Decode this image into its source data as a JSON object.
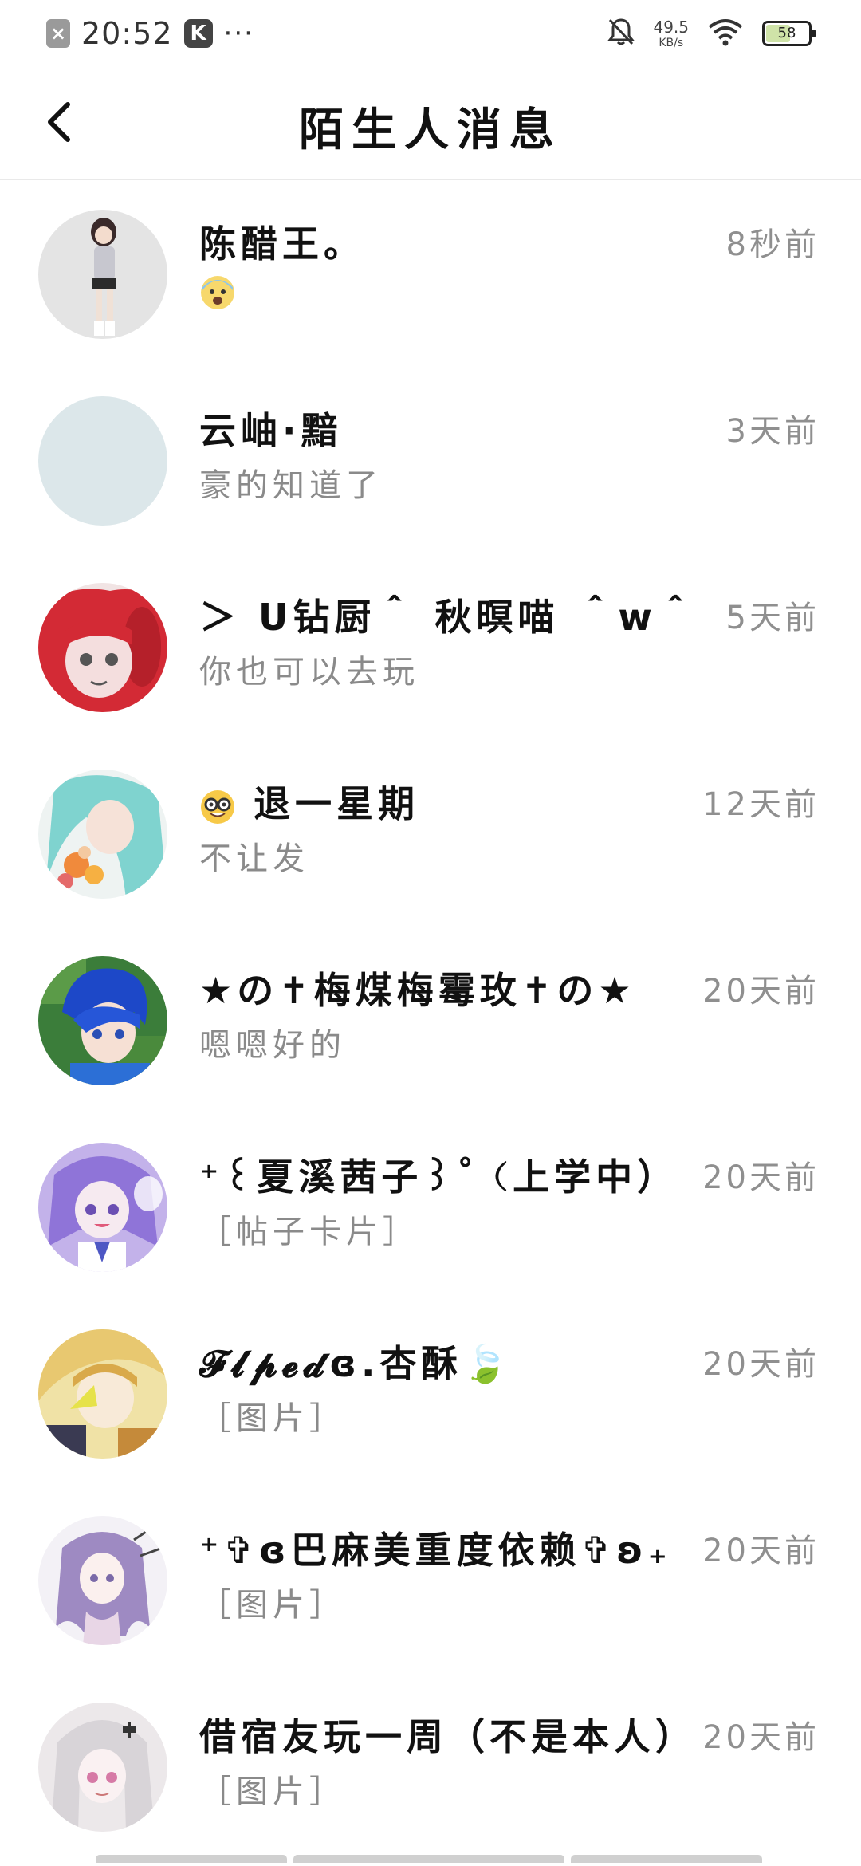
{
  "status_bar": {
    "time": "20:52",
    "badge_k": "K",
    "notification_dots": "···",
    "net_speed_value": "49.5",
    "net_speed_unit": "KB/s",
    "battery_level": "58"
  },
  "header": {
    "title": "陌生人消息"
  },
  "conversations": [
    {
      "name": "陈醋王。",
      "message": "",
      "message_emoji": "anxious-face-emoji",
      "time": "8秒前"
    },
    {
      "name": "云岫·黯",
      "message": "豪的知道了",
      "time": "3天前"
    },
    {
      "name": "＞ U钻厨＾ 秋暝喵 ＾w＾ ＜",
      "message": "你也可以去玩",
      "time": "5天前"
    },
    {
      "name": "退一星期",
      "name_emoji": "nerd-face-emoji",
      "message": "不让发",
      "time": "12天前"
    },
    {
      "name": "★の✝梅煤梅霉玫✝の★",
      "message": "嗯嗯好的",
      "time": "20天前"
    },
    {
      "name": "⁺꒰夏溪茜子꒱˚（上学中）",
      "message": "［帖子卡片］",
      "time": "20天前"
    },
    {
      "name": "𝓕𝓵𝓹𝓮𝓭ɞ.杏酥🍃",
      "message": "［图片］",
      "time": "20天前"
    },
    {
      "name": "⁺✞ɞ巴麻美重度依赖✞ʚ₊",
      "message": "［图片］",
      "time": "20天前"
    },
    {
      "name": "借宿友玩一周（不是本人）",
      "message": "［图片］",
      "time": "20天前"
    }
  ],
  "colors": {
    "text_primary": "#111111",
    "text_secondary": "#8a8a8a",
    "divider": "#e9e9e9",
    "background": "#ffffff"
  }
}
